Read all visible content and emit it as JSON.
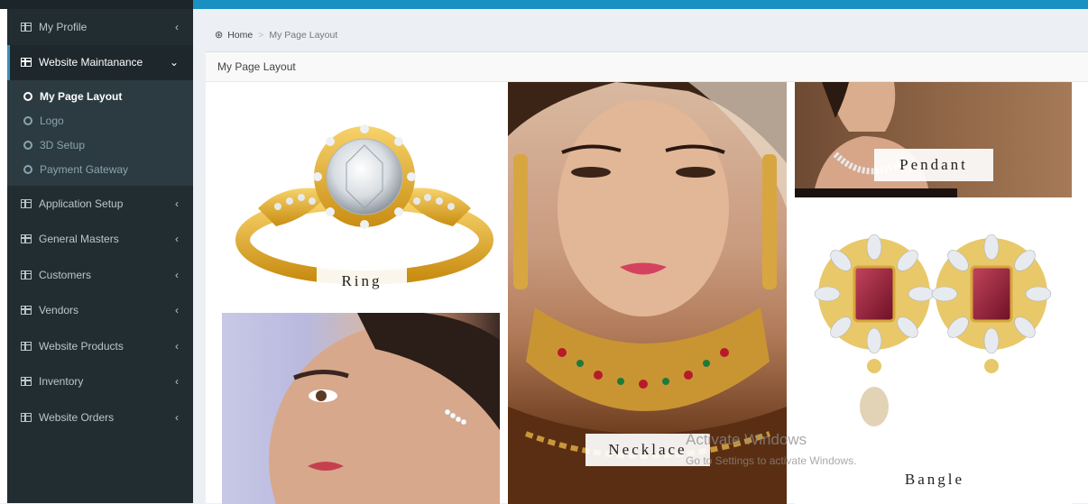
{
  "sidebar": {
    "items": [
      {
        "label": "My Profile"
      },
      {
        "label": "Website Maintanance"
      },
      {
        "label": "Application Setup"
      },
      {
        "label": "General Masters"
      },
      {
        "label": "Customers"
      },
      {
        "label": "Vendors"
      },
      {
        "label": "Website Products"
      },
      {
        "label": "Inventory"
      },
      {
        "label": "Website Orders"
      }
    ],
    "submenu": [
      {
        "label": "My Page Layout"
      },
      {
        "label": "Logo"
      },
      {
        "label": "3D Setup"
      },
      {
        "label": "Payment Gateway"
      }
    ]
  },
  "breadcrumb": {
    "home": "Home",
    "current": "My Page Layout"
  },
  "box": {
    "title": "My Page Layout"
  },
  "gallery": {
    "ring": "Ring",
    "necklace": "Necklace",
    "pendant": "Pendant",
    "bangle": "Bangle"
  },
  "watermark": {
    "line1": "Activate Windows",
    "line2": "Go to Settings to activate Windows."
  },
  "colors": {
    "accent": "#1a8fc1",
    "sidebar": "#222d32",
    "active_border": "#3c8dbc"
  }
}
